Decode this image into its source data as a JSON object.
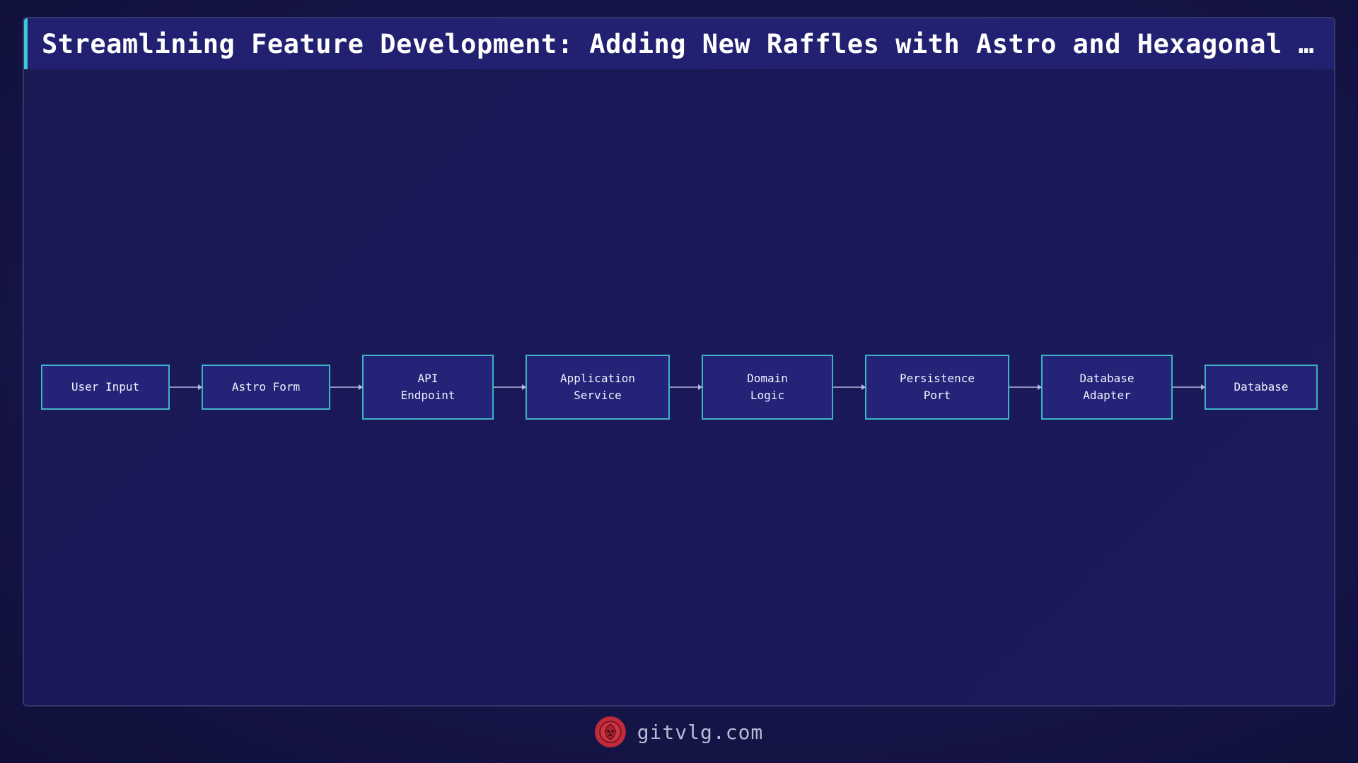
{
  "title": "Streamlining Feature Development: Adding New Raffles with Astro and Hexagonal A…",
  "diagram": {
    "type": "flowchart-horizontal",
    "nodes": [
      {
        "id": "user-input",
        "label": "User Input"
      },
      {
        "id": "astro-form",
        "label": "Astro Form"
      },
      {
        "id": "api-endpoint",
        "label": "API\nEndpoint"
      },
      {
        "id": "application-service",
        "label": "Application\nService"
      },
      {
        "id": "domain-logic",
        "label": "Domain\nLogic"
      },
      {
        "id": "persistence-port",
        "label": "Persistence\nPort"
      },
      {
        "id": "database-adapter",
        "label": "Database\nAdapter"
      },
      {
        "id": "database",
        "label": "Database"
      }
    ],
    "edges": [
      {
        "from": "user-input",
        "to": "astro-form"
      },
      {
        "from": "astro-form",
        "to": "api-endpoint"
      },
      {
        "from": "api-endpoint",
        "to": "application-service"
      },
      {
        "from": "application-service",
        "to": "domain-logic"
      },
      {
        "from": "domain-logic",
        "to": "persistence-port"
      },
      {
        "from": "persistence-port",
        "to": "database-adapter"
      },
      {
        "from": "database-adapter",
        "to": "database"
      }
    ],
    "colors": {
      "node_fill": "#232378",
      "node_border": "#3fb2c8",
      "edge": "#8c8fc0",
      "title_accent": "#3ec9d6"
    }
  },
  "footer": {
    "logo_icon": "lion-logo-icon",
    "site": "gitvlg.com"
  }
}
